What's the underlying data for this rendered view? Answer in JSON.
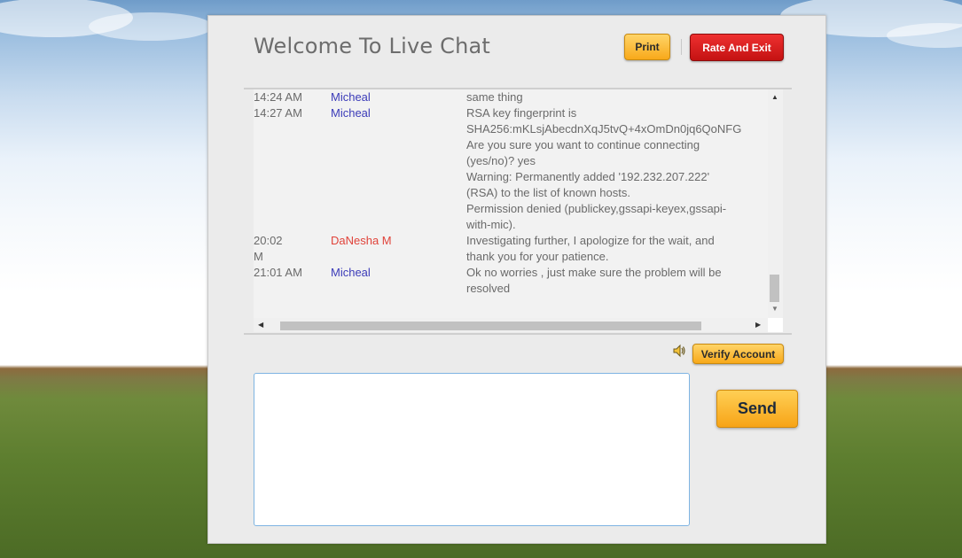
{
  "header": {
    "title": "Welcome To Live Chat",
    "print_label": "Print",
    "exit_label": "Rate And Exit"
  },
  "transcript": {
    "partial_line": "same thing",
    "messages": [
      {
        "time": "14:24 AM",
        "name": "Micheal",
        "role": "user",
        "text": ""
      },
      {
        "time": "14:27 AM",
        "name": "Micheal",
        "role": "user",
        "text": "RSA key fingerprint is\nSHA256:mKLsjAbecdnXqJ5tvQ+4xOmDn0jq6QoNFG\nAre you sure you want to continue connecting\n(yes/no)? yes\nWarning: Permanently added '192.232.207.222'\n(RSA) to the list of known hosts.\nPermission denied (publickey,gssapi-keyex,gssapi-\nwith-mic)."
      },
      {
        "time": "20:02\nM",
        "name": "DaNesha M",
        "role": "agent",
        "text": "Investigating further, I apologize for the wait, and\nthank you for your patience."
      },
      {
        "time": "21:01 AM",
        "name": "Micheal",
        "role": "user",
        "text": "Ok no worries , just make sure the problem will be\nresolved"
      }
    ]
  },
  "controls": {
    "verify_label": "Verify Account",
    "send_label": "Send",
    "message_placeholder": ""
  },
  "icons": {
    "speaker": "speaker-icon",
    "scroll_up": "arrow-up-icon",
    "scroll_down": "arrow-down-icon",
    "scroll_left": "arrow-left-icon",
    "scroll_right": "arrow-right-icon"
  },
  "colors": {
    "agent_name": "#e0433a",
    "user_name": "#3b3bb8",
    "exit_button": "#d11b1b",
    "primary_button": "#f8a91a"
  }
}
